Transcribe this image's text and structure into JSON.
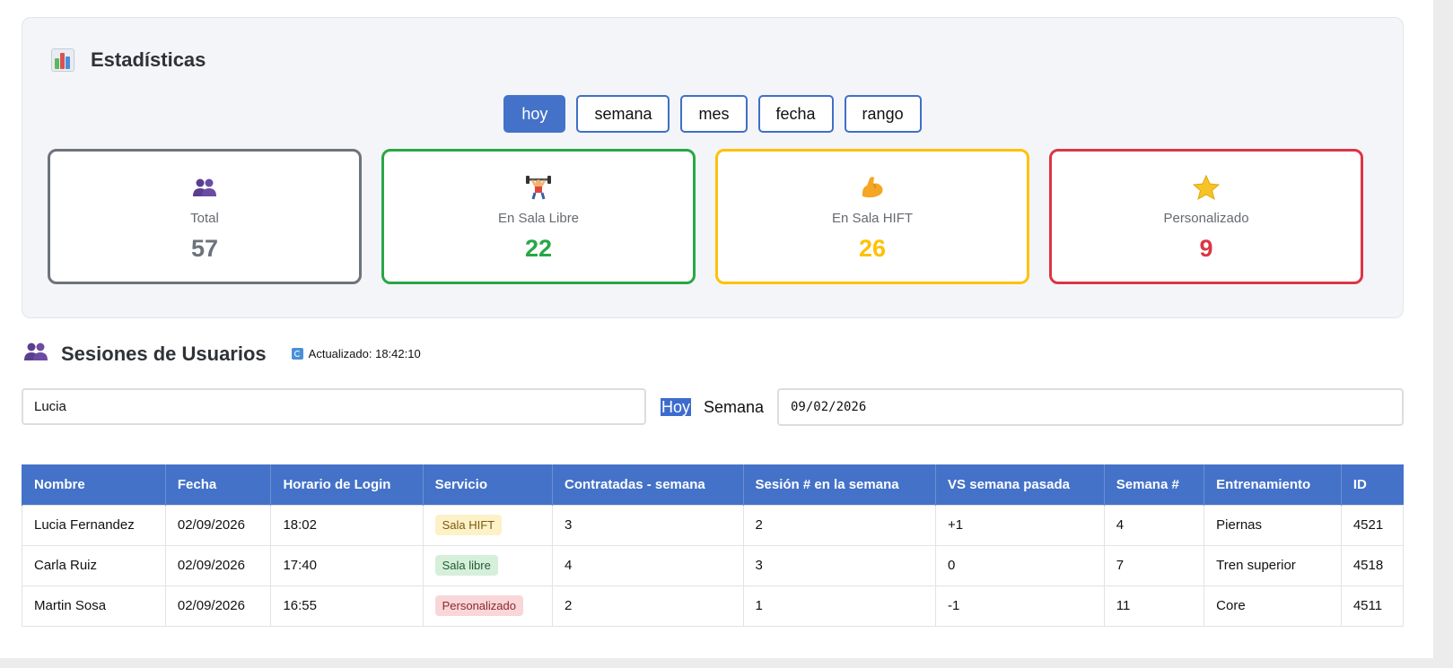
{
  "stats": {
    "title": "Estadísticas",
    "icon": "bar-chart-icon",
    "filters": [
      {
        "label": "hoy",
        "active": true
      },
      {
        "label": "semana",
        "active": false
      },
      {
        "label": "mes",
        "active": false
      },
      {
        "label": "fecha",
        "active": false
      },
      {
        "label": "rango",
        "active": false
      }
    ],
    "boxes": [
      {
        "label": "Total",
        "value": "57",
        "color": "#6c737c",
        "icon": "users-icon"
      },
      {
        "label": "En Sala Libre",
        "value": "22",
        "color": "#28a745",
        "icon": "weightlifter-icon"
      },
      {
        "label": "En Sala HIFT",
        "value": "26",
        "color": "#ffc107",
        "icon": "flexed-biceps-icon"
      },
      {
        "label": "Personalizado",
        "value": "9",
        "color": "#dc3545",
        "icon": "star-icon"
      }
    ]
  },
  "sessions": {
    "title": "Sesiones de Usuarios",
    "icon": "users-icon",
    "updated_label": "Actualizado: 18:42:10",
    "search_value": "Lucia",
    "quick_filters": {
      "today": "Hoy",
      "week": "Semana"
    },
    "date_value": "09/02/2026",
    "columns": [
      "Nombre",
      "Fecha",
      "Horario de Login",
      "Servicio",
      "Contratadas - semana",
      "Sesión # en la semana",
      "VS semana pasada",
      "Semana #",
      "Entrenamiento",
      "ID"
    ],
    "rows": [
      {
        "nombre": "Lucia Fernandez",
        "fecha": "02/09/2026",
        "horario": "18:02",
        "servicio": "Sala HIFT",
        "servicio_tipo": "hift",
        "contratadas": "3",
        "sesion": "2",
        "vs": "+1",
        "semana": "4",
        "entrenamiento": "Piernas",
        "id": "4521"
      },
      {
        "nombre": "Carla Ruiz",
        "fecha": "02/09/2026",
        "horario": "17:40",
        "servicio": "Sala libre",
        "servicio_tipo": "libre",
        "contratadas": "4",
        "sesion": "3",
        "vs": "0",
        "semana": "7",
        "entrenamiento": "Tren superior",
        "id": "4518"
      },
      {
        "nombre": "Martin Sosa",
        "fecha": "02/09/2026",
        "horario": "16:55",
        "servicio": "Personalizado",
        "servicio_tipo": "pers",
        "contratadas": "2",
        "sesion": "1",
        "vs": "-1",
        "semana": "11",
        "entrenamiento": "Core",
        "id": "4511"
      }
    ]
  }
}
